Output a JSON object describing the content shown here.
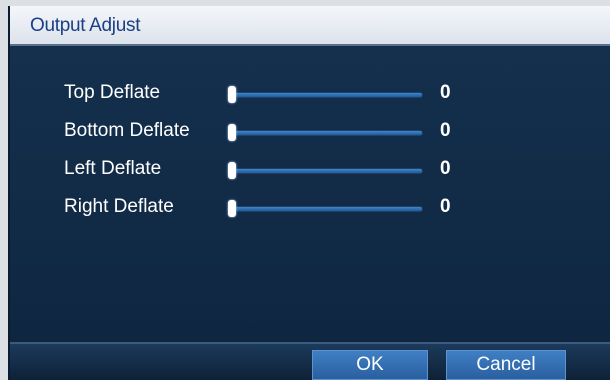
{
  "dialog": {
    "title": "Output Adjust"
  },
  "settings": [
    {
      "label": "Top Deflate",
      "value": "0",
      "level": 0
    },
    {
      "label": "Bottom Deflate",
      "value": "0",
      "level": 0
    },
    {
      "label": "Left Deflate",
      "value": "0",
      "level": 0
    },
    {
      "label": "Right Deflate",
      "value": "0",
      "level": 0
    }
  ],
  "buttons": {
    "ok": "OK",
    "cancel": "Cancel"
  },
  "colors": {
    "panel_background": "#122a44",
    "title_text": "#1b3f86",
    "slider_track": "#3c86d0",
    "button": "#3f7fc4"
  }
}
